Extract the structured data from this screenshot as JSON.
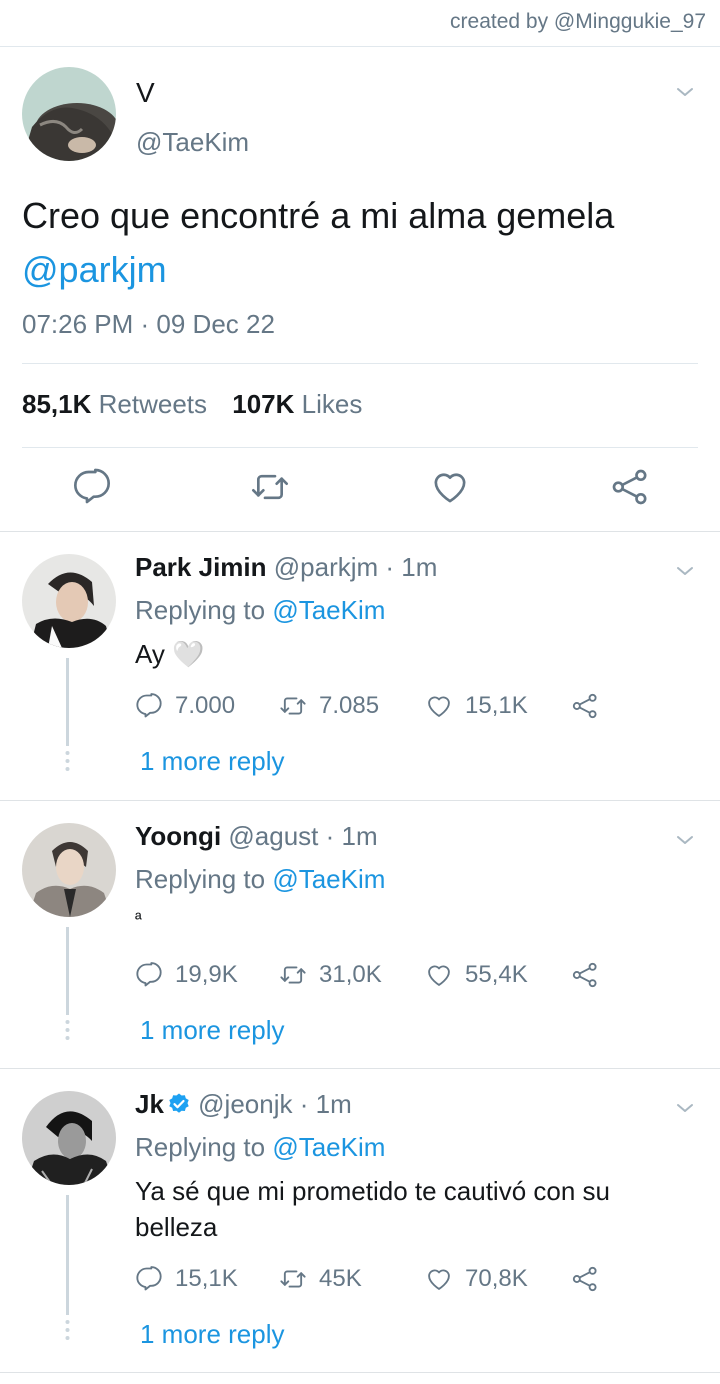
{
  "credit": "created by @Minggukie_97",
  "main_tweet": {
    "name": "V",
    "handle": "@TaeKim",
    "text": "Creo que encontré a mi alma gemela ",
    "mention": "@parkjm",
    "time": "07:26 PM · 09 Dec 22",
    "retweets_count": "85,1K",
    "retweets_label": "Retweets",
    "likes_count": "107K",
    "likes_label": "Likes"
  },
  "replies": [
    {
      "name": "Park Jimin",
      "handle": "@parkjm",
      "time": "1m",
      "replying_prefix": "Replying to ",
      "replying_handle": "@TaeKim",
      "text": "Ay 🤍",
      "replies": "7.000",
      "retweets": "7.085",
      "likes": "15,1K",
      "more": "1 more reply"
    },
    {
      "name": "Yoongi",
      "handle": "@agust",
      "time": "1m",
      "replying_prefix": "Replying to ",
      "replying_handle": "@TaeKim",
      "text": "ª",
      "replies": "19,9K",
      "retweets": "31,0K",
      "likes": "55,4K",
      "more": "1 more reply"
    },
    {
      "name": "Jk",
      "verified": true,
      "handle": "@jeonjk",
      "time": "1m",
      "replying_prefix": "Replying to ",
      "replying_handle": "@TaeKim",
      "text": "Ya sé que mi prometido te cautivó con su belleza",
      "replies": "15,1K",
      "retweets": "45K",
      "likes": "70,8K",
      "more": "1 more reply"
    }
  ],
  "icons": [
    "reply-icon",
    "retweet-icon",
    "like-icon",
    "share-icon",
    "chevron-down-icon",
    "verified-badge-icon"
  ],
  "colors": {
    "link": "#1b95e0",
    "muted": "#657786",
    "text": "#14171a",
    "divider": "#e1e8ed"
  }
}
